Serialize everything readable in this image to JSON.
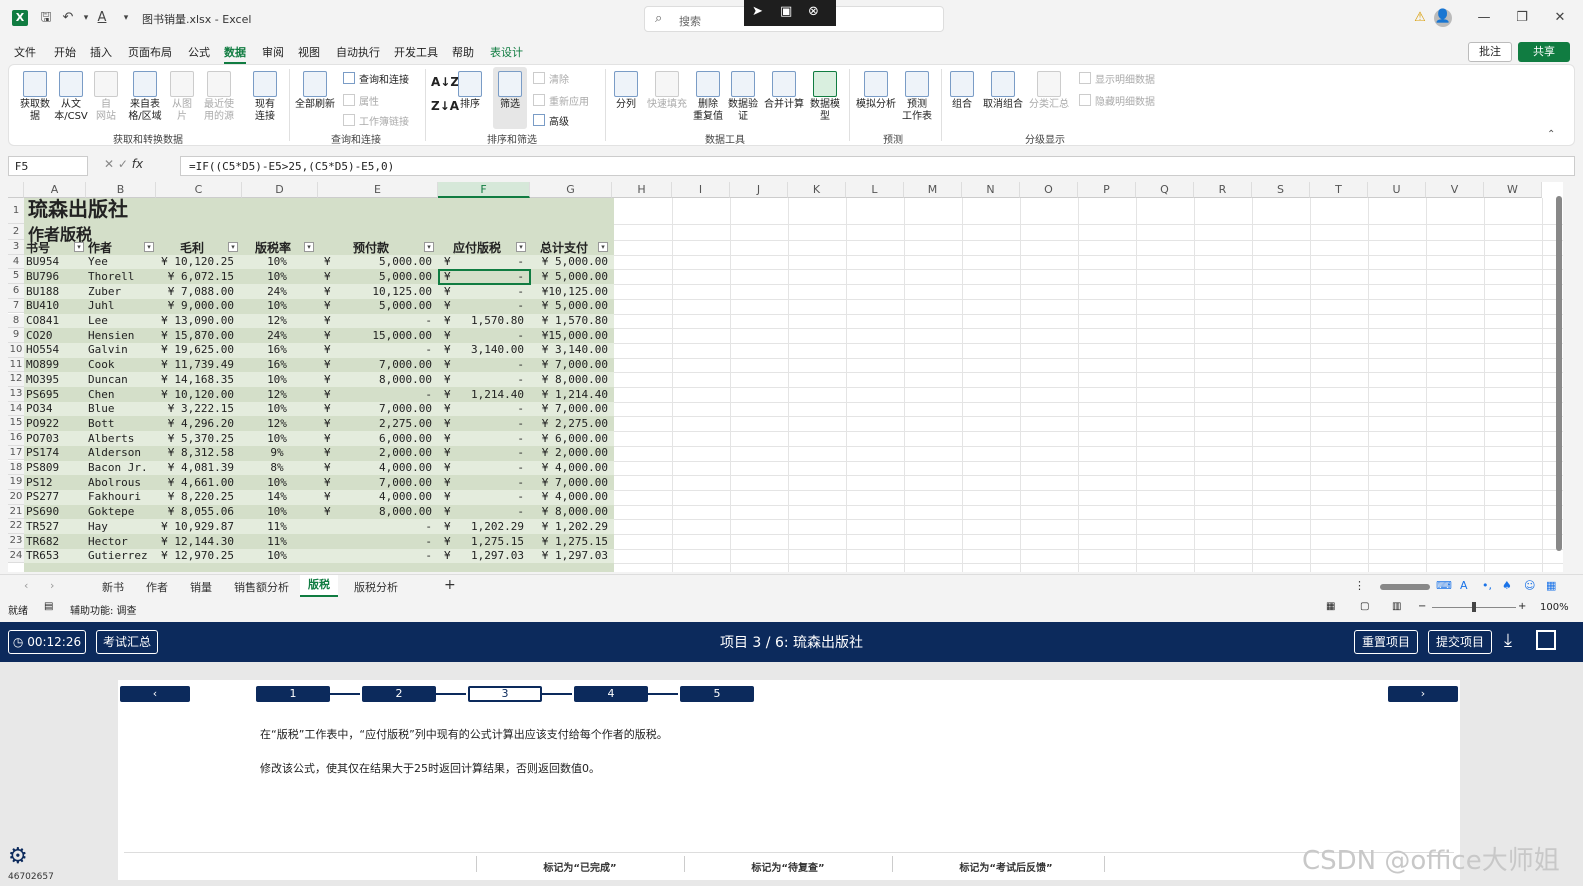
{
  "titlebar": {
    "doc_title": "图书销量.xlsx  -  Excel",
    "search_placeholder": "搜索",
    "win_controls": [
      "⚠",
      "—",
      "❐",
      "✕"
    ]
  },
  "menu": [
    "文件",
    "开始",
    "插入",
    "页面布局",
    "公式",
    "数据",
    "审阅",
    "视图",
    "自动执行",
    "开发工具",
    "帮助",
    "表设计"
  ],
  "menu_active": "数据",
  "menu_right": {
    "comment": "批注",
    "share": "共享"
  },
  "ribbon": {
    "groups": [
      {
        "label": "获取和转换数据"
      },
      {
        "label": "查询和连接"
      },
      {
        "label": "排序和筛选"
      },
      {
        "label": "数据工具"
      },
      {
        "label": "预测"
      },
      {
        "label": "分级显示"
      }
    ],
    "buttons": {
      "get_data": "获取数\n据",
      "from_csv": "从文\n本/CSV",
      "from_web": "自\n网站",
      "from_table": "来自表\n格/区域",
      "from_pic": "从图\n片",
      "recent": "最近使\n用的源",
      "existing": "现有\n连接",
      "refresh_all": "全部刷新",
      "queries": "查询和连接",
      "properties": "属性",
      "workbook_links": "工作簿链接",
      "sort": "排序",
      "filter": "筛选",
      "clear": "清除",
      "reapply": "重新应用",
      "advanced": "高级",
      "split": "分列",
      "flash": "快速填充",
      "remove_dup": "删除\n重复值",
      "validation": "数据验\n证",
      "consolidate": "合并计算",
      "data_model": "数据模\n型",
      "whatif": "模拟分析",
      "forecast": "预测\n工作表",
      "group": "组合",
      "ungroup": "取消组合",
      "subtotal": "分类汇总",
      "show_detail": "显示明细数据",
      "hide_detail": "隐藏明细数据"
    }
  },
  "formula_bar": {
    "name_box": "F5",
    "formula": "=IF((C5*D5)-E5>25,(C5*D5)-E5,0)"
  },
  "grid": {
    "columns": [
      "A",
      "B",
      "C",
      "D",
      "E",
      "F",
      "G",
      "H",
      "I",
      "J",
      "K",
      "L",
      "M",
      "N",
      "O",
      "P",
      "Q",
      "R",
      "S",
      "T",
      "U",
      "V",
      "W"
    ],
    "selected_col": "F",
    "rows": [
      "1",
      "2",
      "3",
      "4",
      "5",
      "6",
      "7",
      "8",
      "9",
      "10",
      "11",
      "12",
      "13",
      "14",
      "15",
      "16",
      "17",
      "18",
      "19",
      "20",
      "21",
      "22",
      "23",
      "24"
    ],
    "title": "琉森出版社",
    "subtitle": "作者版税",
    "headers": [
      "书号",
      "作者",
      "毛利",
      "版税率",
      "预付款",
      "应付版税",
      "总计支付"
    ],
    "data": [
      [
        "BU954",
        "Yee",
        "¥ 10,120.25",
        "10%",
        "¥",
        "5,000.00",
        "¥",
        "-",
        "¥ 5,000.00"
      ],
      [
        "BU796",
        "Thorell",
        "¥  6,072.15",
        "10%",
        "¥",
        "5,000.00",
        "¥",
        "-",
        "¥ 5,000.00"
      ],
      [
        "BU188",
        "Zuber",
        "¥  7,088.00",
        "24%",
        "¥",
        "10,125.00",
        "¥",
        "-",
        "¥10,125.00"
      ],
      [
        "BU410",
        "Juhl",
        "¥  9,000.00",
        "10%",
        "¥",
        "5,000.00",
        "¥",
        "-",
        "¥ 5,000.00"
      ],
      [
        "CO841",
        "Lee",
        "¥ 13,090.00",
        "12%",
        "¥",
        "-",
        "¥",
        "1,570.80",
        "¥ 1,570.80"
      ],
      [
        "CO20",
        "Hensien",
        "¥ 15,870.00",
        "24%",
        "¥",
        "15,000.00",
        "¥",
        "-",
        "¥15,000.00"
      ],
      [
        "HO554",
        "Galvin",
        "¥ 19,625.00",
        "16%",
        "¥",
        "-",
        "¥",
        "3,140.00",
        "¥ 3,140.00"
      ],
      [
        "MO899",
        "Cook",
        "¥ 11,739.49",
        "16%",
        "¥",
        "7,000.00",
        "¥",
        "-",
        "¥ 7,000.00"
      ],
      [
        "MO395",
        "Duncan",
        "¥ 14,168.35",
        "10%",
        "¥",
        "8,000.00",
        "¥",
        "-",
        "¥ 8,000.00"
      ],
      [
        "PS695",
        "Chen",
        "¥ 10,120.00",
        "12%",
        "¥",
        "-",
        "¥",
        "1,214.40",
        "¥ 1,214.40"
      ],
      [
        "PO34",
        "Blue",
        "¥  3,222.15",
        "10%",
        "¥",
        "7,000.00",
        "¥",
        "-",
        "¥ 7,000.00"
      ],
      [
        "PO922",
        "Bott",
        "¥  4,296.20",
        "12%",
        "¥",
        "2,275.00",
        "¥",
        "-",
        "¥ 2,275.00"
      ],
      [
        "PO703",
        "Alberts",
        "¥  5,370.25",
        "10%",
        "¥",
        "6,000.00",
        "¥",
        "-",
        "¥ 6,000.00"
      ],
      [
        "PS174",
        "Alderson",
        "¥  8,312.58",
        "9%",
        "¥",
        "2,000.00",
        "¥",
        "-",
        "¥ 2,000.00"
      ],
      [
        "PS809",
        "Bacon Jr.",
        "¥  4,081.39",
        "8%",
        "¥",
        "4,000.00",
        "¥",
        "-",
        "¥ 4,000.00"
      ],
      [
        "PS12",
        "Abolrous",
        "¥  4,661.00",
        "10%",
        "¥",
        "7,000.00",
        "¥",
        "-",
        "¥ 7,000.00"
      ],
      [
        "PS277",
        "Fakhouri",
        "¥  8,220.25",
        "14%",
        "¥",
        "4,000.00",
        "¥",
        "-",
        "¥ 4,000.00"
      ],
      [
        "PS690",
        "Goktepe",
        "¥  8,055.06",
        "10%",
        "¥",
        "8,000.00",
        "¥",
        "-",
        "¥ 8,000.00"
      ],
      [
        "TR527",
        "Hay",
        "¥ 10,929.87",
        "11%",
        "",
        "-",
        "¥",
        "1,202.29",
        "¥ 1,202.29"
      ],
      [
        "TR682",
        "Hector",
        "¥ 12,144.30",
        "11%",
        "",
        "-",
        "¥",
        "1,275.15",
        "¥ 1,275.15"
      ],
      [
        "TR653",
        "Gutierrez",
        "¥ 12,970.25",
        "10%",
        "",
        "-",
        "¥",
        "1,297.03",
        "¥ 1,297.03"
      ]
    ]
  },
  "sheets": [
    "新书",
    "作者",
    "销量",
    "销售额分析",
    "版税",
    "版税分析"
  ],
  "active_sheet": "版税",
  "statusbar": {
    "ready": "就绪",
    "accessibility": "辅助功能: 调查",
    "zoom": "100%"
  },
  "exam": {
    "timer": "00:12:26",
    "summary": "考试汇总",
    "title": "项目 3 / 6: 琉森出版社",
    "reset": "重置项目",
    "submit": "提交项目",
    "nav_prev": "‹",
    "nav_next": "›",
    "steps": [
      "1",
      "2",
      "3",
      "4",
      "5"
    ],
    "current_step": "3",
    "task_line1": "在“版税”工作表中，“应付版税”列中现有的公式计算出应该支付给每个作者的版税。",
    "task_line2": "修改该公式，使其仅在结果大于25时返回计算结果，否则返回数值0。",
    "mark_done": "标记为“已完成”",
    "mark_review": "标记为“待复查”",
    "mark_feedback": "标记为“考试后反馈”",
    "exam_id": "46702657"
  },
  "watermark": "CSDN @office大师姐",
  "colors": {
    "excel_green": "#107c41",
    "exam_navy": "#0c2a5c",
    "table_band": "#d4dfc9"
  }
}
